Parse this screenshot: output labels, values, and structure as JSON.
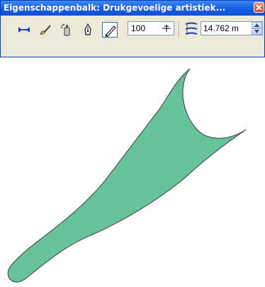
{
  "window": {
    "title": "Eigenschappenbalk: Drukgevoelige artistiek..."
  },
  "toolbar": {
    "icons": [
      "preset-stroke-icon",
      "brush-icon",
      "sprayer-icon",
      "calligraphic-icon",
      "pressure-pen-icon"
    ],
    "active_tool": "pressure-pen-icon",
    "width_value": "100",
    "angle_value": "14.762 m"
  },
  "colors": {
    "titlebar": "#0d4fd6",
    "toolbar_bg": "#ece9d8",
    "shape_fill": "#66c49d",
    "shape_stroke": "#505050"
  }
}
